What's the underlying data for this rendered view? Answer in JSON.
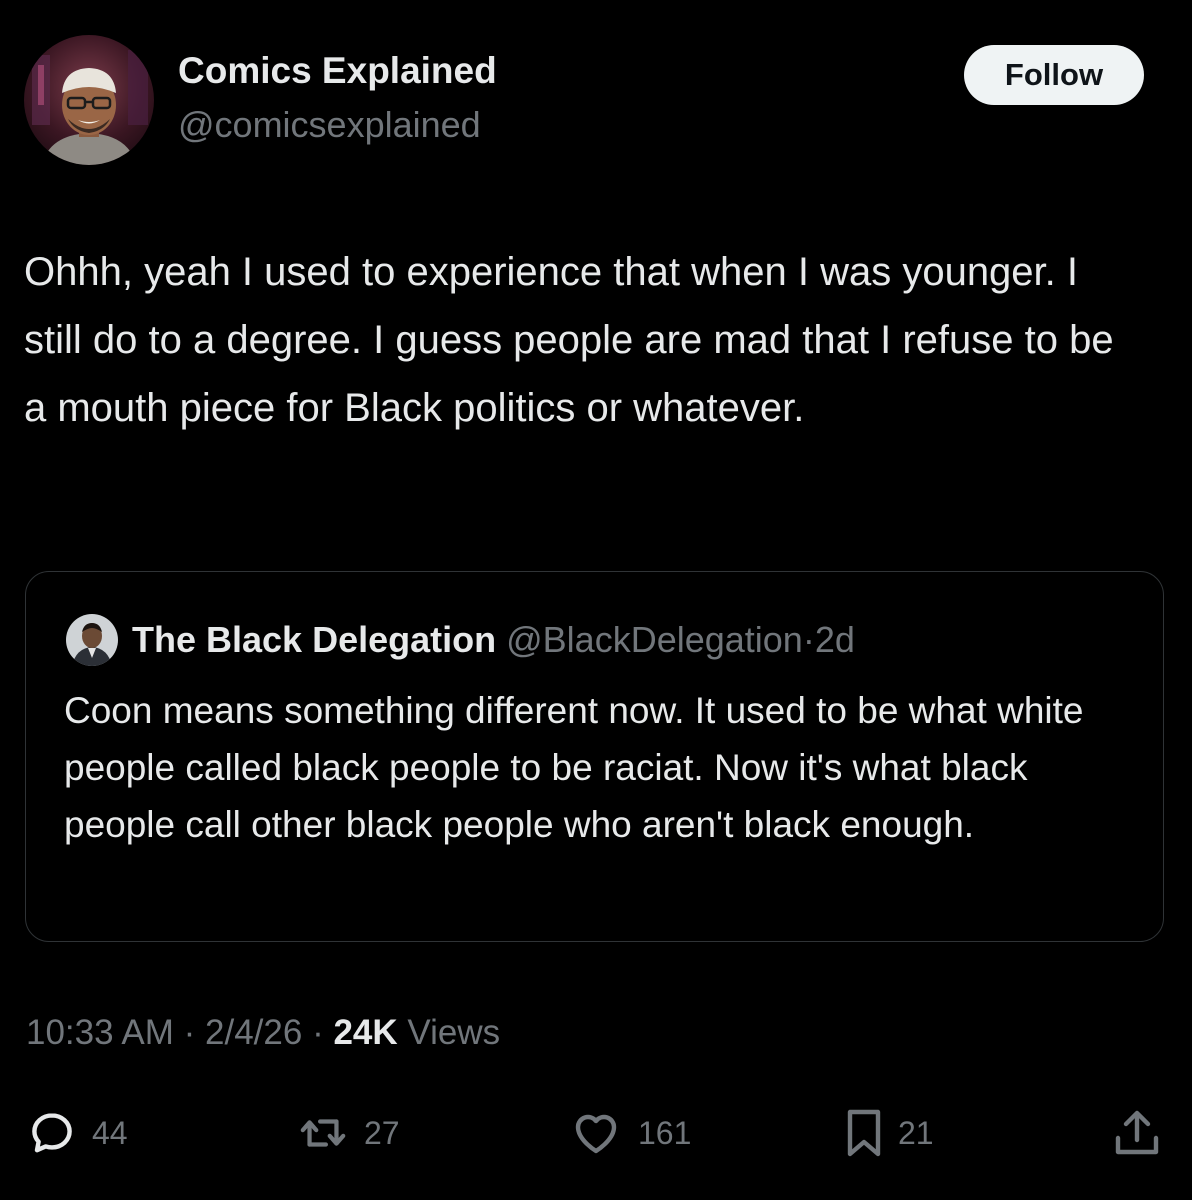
{
  "author": {
    "display_name": "Comics Explained",
    "handle": "@comicsexplained"
  },
  "follow_label": "Follow",
  "tweet_text": "Ohhh, yeah I used to experience that when I was younger. I still do to a degree. I guess people are mad that I refuse to be a mouth piece for Black politics or whatever.",
  "quote": {
    "display_name": "The Black Delegation",
    "handle": "@BlackDelegation",
    "separator": "·",
    "age": "2d",
    "text": "Coon means something different now. It used to be what white people called black people to be raciat. Now it's what black people call other black people who aren't black enough."
  },
  "meta": {
    "time": "10:33 AM",
    "separator": "·",
    "date": "2/4/26",
    "views_count": "24K",
    "views_label": "Views"
  },
  "actions": {
    "replies": "44",
    "reposts": "27",
    "likes": "161",
    "bookmarks": "21"
  },
  "colors": {
    "background": "#000000",
    "text_primary": "#e7e9ea",
    "text_secondary": "#71767b",
    "border": "#2f3336",
    "follow_bg": "#eff3f4"
  },
  "icons": [
    "reply-icon",
    "repost-icon",
    "like-icon",
    "bookmark-icon",
    "share-icon"
  ]
}
